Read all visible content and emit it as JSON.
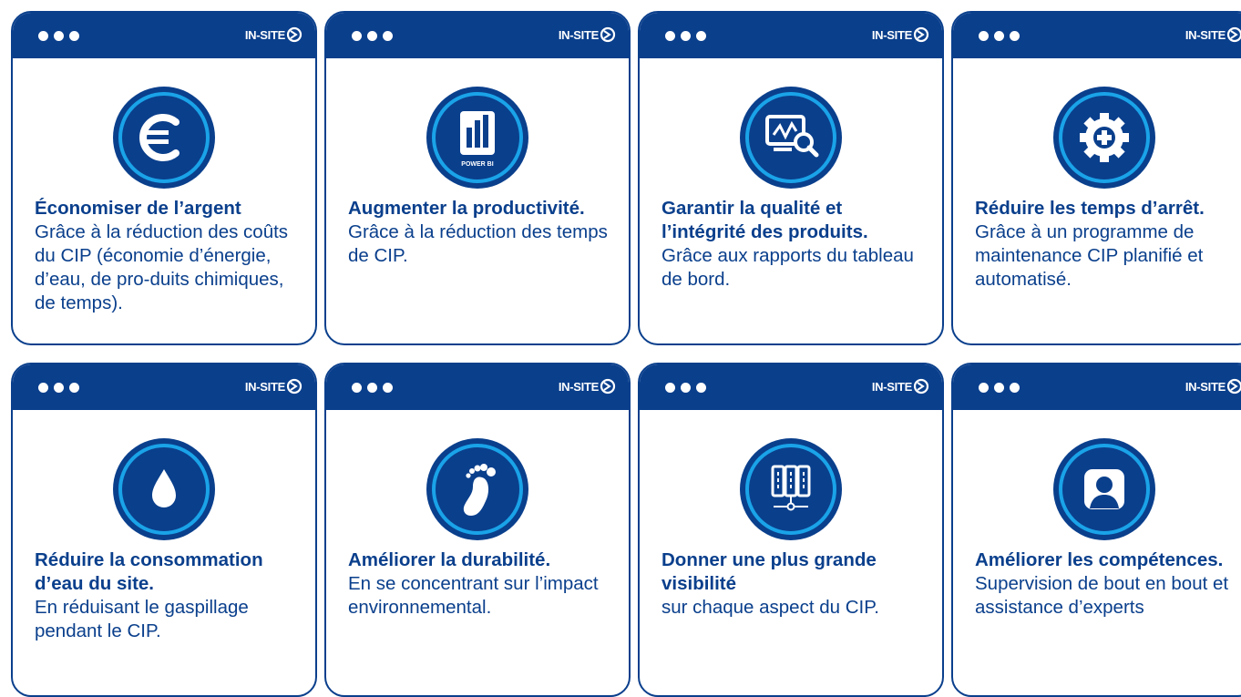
{
  "colors": {
    "brand": "#0a3f8c",
    "ring": "#1aa3e8",
    "white": "#ffffff"
  },
  "logo_text": "IN-SITE",
  "cards": [
    {
      "icon": "euro-icon",
      "title": "Économiser de l’argent",
      "body": "Grâce à la réduction des coûts du CIP (économie d’énergie, d’eau, de pro-duits chimiques, de temps)."
    },
    {
      "icon": "power-bi-icon",
      "icon_label": "POWER BI",
      "title": "Augmenter la productivité.",
      "body": "Grâce à la réduction des temps de CIP."
    },
    {
      "icon": "dashboard-quality-icon",
      "title": "Garantir la qualité et l’intégrité des produits.",
      "body": "Grâce aux rapports du tableau de bord."
    },
    {
      "icon": "gear-plus-icon",
      "title": "Réduire les temps d’arrêt.",
      "body": "Grâce à un programme de maintenance CIP planifié et automatisé."
    },
    {
      "icon": "water-drop-icon",
      "title": "Réduire la consommation d’eau du site.",
      "body": "En réduisant le gaspillage pendant le CIP."
    },
    {
      "icon": "footprint-icon",
      "title": "Améliorer la durabilité.",
      "body": "En se concentrant sur l’impact environnemental."
    },
    {
      "icon": "server-network-icon",
      "title": "Donner une plus grande visibilité",
      "body": "sur chaque aspect du CIP."
    },
    {
      "icon": "user-icon",
      "title": "Améliorer les compétences.",
      "body": "Supervision de bout en bout et assistance d’experts"
    }
  ]
}
